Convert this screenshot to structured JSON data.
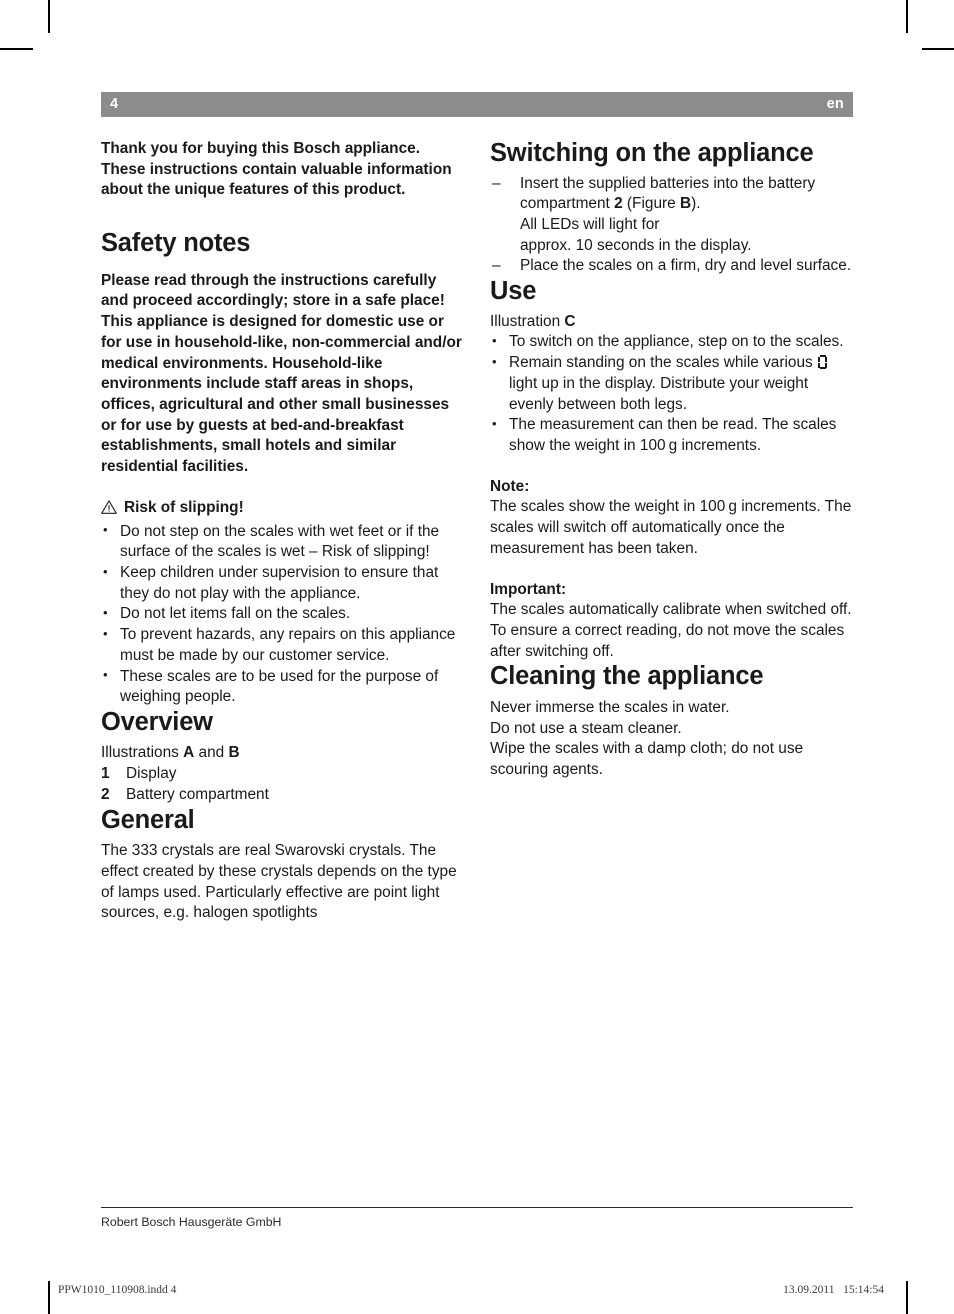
{
  "header": {
    "page_number": "4",
    "language": "en"
  },
  "left_column": {
    "intro": "Thank you for buying this Bosch appliance. These instructions contain valuable information about the unique features of this product.",
    "safety": {
      "heading": "Safety notes",
      "para1": "Please read through the instructions carefully and proceed accordingly; store in a safe place!",
      "para2": "This appliance is designed for domestic use or for use in household-like, non-commercial and/or medical environments. Household-like environments include staff areas in shops, offices, agricultural and other small businesses or for use by guests at bed-and-breakfast establishments, small hotels and similar residential facilities.",
      "warning_title": "Risk of slipping!",
      "warning_icon": "warning-triangle-icon",
      "bullets": [
        "Do not step on the scales with wet feet or if the surface of the scales is wet – Risk of slipping!",
        "Keep children under supervision to ensure that they do not play with the appliance.",
        "Do not let items fall on the scales.",
        "To prevent hazards, any repairs on this appliance must be made by our customer service.",
        "These scales are to be used for the purpose of weighing people."
      ]
    },
    "overview": {
      "heading": "Overview",
      "illustrations_prefix": "Illustrations ",
      "illustration_a": "A",
      "illustrations_conjunction": " and ",
      "illustration_b": "B",
      "items": [
        {
          "num": "1",
          "label": "Display"
        },
        {
          "num": "2",
          "label": "Battery compartment"
        }
      ]
    },
    "general": {
      "heading": "General",
      "text": "The 333 crystals are real Swarovski crystals. The effect created by these crystals depends on the type of lamps used. Particularly effective are point light sources, e.g. halogen spotlights"
    }
  },
  "right_column": {
    "switching_on": {
      "heading": "Switching on the appliance",
      "steps": [
        {
          "part1": "Insert the supplied batteries into the battery compartment ",
          "bold1": "2",
          "part2": " (Figure ",
          "bold2": "B",
          "part3": ").",
          "line2": "All LEDs will light for",
          "line3": "approx. 10 seconds in the display."
        },
        {
          "text": "Place the scales on a firm, dry and level surface."
        }
      ]
    },
    "use": {
      "heading": "Use",
      "illustration_prefix": "Illustration ",
      "illustration_letter": "C",
      "bullets": [
        {
          "text": "To switch on the appliance, step on to the scales."
        },
        {
          "before_glyph": "Remain standing on the scales while various ",
          "glyph": "seven-segment-digit-icon",
          "after_glyph": " light up in the display. Distribute your weight evenly between both legs."
        },
        {
          "text": "The measurement can then be read. The scales show the weight in 100 g increments."
        }
      ],
      "note_label": "Note:",
      "note_text": "The scales show the weight in 100 g increments. The scales will switch off automatically once the measurement has been taken.",
      "important_label": "Important:",
      "important_text_1": "The scales automatically calibrate when switched off.",
      "important_text_2": "To ensure a correct reading, do not move the scales after switching off."
    },
    "cleaning": {
      "heading": "Cleaning the appliance",
      "line1": "Never immerse the scales in water.",
      "line2": "Do not use a steam cleaner.",
      "line3": "Wipe the scales with a damp cloth; do not use scouring agents."
    }
  },
  "footer": {
    "company": "Robert Bosch Hausgeräte GmbH"
  },
  "slug": {
    "file": "PPW1010_110908.indd   4",
    "timestamp": "13.09.2011   15:14:54"
  },
  "colors": {
    "header_bar": "#8c8c8c",
    "header_text": "#ffffff",
    "body_text": "#1a1a1a"
  }
}
